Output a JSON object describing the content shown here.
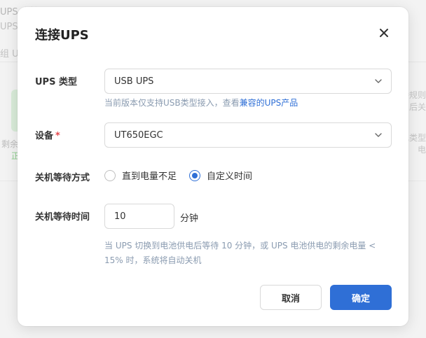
{
  "background": {
    "header_title": "UPS 支持",
    "header_sub": "UPS",
    "tab_label": "组 U",
    "left_text_1": "剩余",
    "left_text_2": "正",
    "right_text_1": "持规则",
    "right_text_2": "后关",
    "right_text_3": "电类型",
    "right_text_4": "电"
  },
  "modal": {
    "title": "连接UPS",
    "ups_type": {
      "label": "UPS 类型",
      "value": "USB UPS",
      "hint_prefix": "当前版本仅支持USB类型接入，查看",
      "hint_link": "兼容的UPS产品"
    },
    "device": {
      "label": "设备",
      "required_mark": "*",
      "value": "UT650EGC"
    },
    "shutdown_mode": {
      "label": "关机等待方式",
      "options": [
        "直到电量不足",
        "自定义时间"
      ],
      "selected": "自定义时间"
    },
    "shutdown_time": {
      "label": "关机等待时间",
      "value": "10",
      "unit": "分钟",
      "description": "当 UPS 切换到电池供电后等待 10 分钟，或 UPS 电池供电的剩余电量 < 15% 时，系统将自动关机"
    },
    "buttons": {
      "cancel": "取消",
      "ok": "确定"
    }
  },
  "colors": {
    "primary": "#2f6fd6",
    "required": "#e5484d",
    "hint": "#8a9bb0"
  }
}
